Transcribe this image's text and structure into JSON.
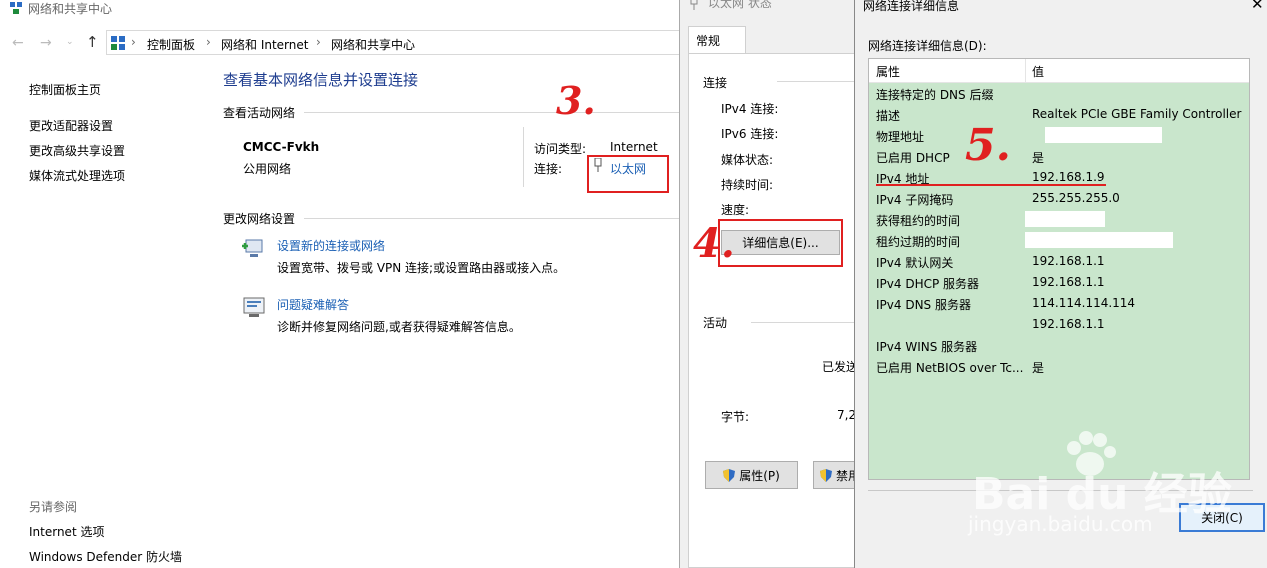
{
  "window": {
    "title": "网络和共享中心",
    "breadcrumb": [
      "控制面板",
      "网络和 Internet",
      "网络和共享中心"
    ]
  },
  "sidebar": {
    "home": "控制面板主页",
    "items": [
      "更改适配器设置",
      "更改高级共享设置",
      "媒体流式处理选项"
    ],
    "see_also_title": "另请参阅",
    "see_also": [
      "Internet 选项",
      "Windows Defender 防火墙"
    ]
  },
  "main": {
    "heading": "查看基本网络信息并设置连接",
    "active_networks_label": "查看活动网络",
    "network_name": "CMCC-Fvkh",
    "network_type": "公用网络",
    "access_type_label": "访问类型:",
    "access_type_value": "Internet",
    "connection_label": "连接:",
    "connection_value": "以太网",
    "change_settings_label": "更改网络设置",
    "actions": [
      {
        "title": "设置新的连接或网络",
        "desc": "设置宽带、拨号或 VPN 连接;或设置路由器或接入点。"
      },
      {
        "title": "问题疑难解答",
        "desc": "诊断并修复网络问题,或者获得疑难解答信息。"
      }
    ]
  },
  "status_dialog": {
    "title": "以太网 状态",
    "tab": "常规",
    "connection_group": "连接",
    "fields": [
      "IPv4 连接:",
      "IPv6 连接:",
      "媒体状态:",
      "持续时间:",
      "速度:"
    ],
    "details_button": "详细信息(E)...",
    "activity_group": "活动",
    "sent_label": "已发送",
    "bytes_label": "字节:",
    "bytes_sent": "7,2",
    "properties_button": "属性(P)",
    "disable_button": "禁用"
  },
  "details_dialog": {
    "title": "网络连接详细信息",
    "label": "网络连接详细信息(D):",
    "col_property": "属性",
    "col_value": "值",
    "rows": [
      {
        "k": "连接特定的 DNS 后缀",
        "v": ""
      },
      {
        "k": "描述",
        "v": "Realtek PCIe GBE Family Controller"
      },
      {
        "k": "物理地址",
        "v": ""
      },
      {
        "k": "已启用 DHCP",
        "v": "是"
      },
      {
        "k": "IPv4 地址",
        "v": "192.168.1.9"
      },
      {
        "k": "IPv4 子网掩码",
        "v": "255.255.255.0"
      },
      {
        "k": "获得租约的时间",
        "v": ""
      },
      {
        "k": "租约过期的时间",
        "v": ""
      },
      {
        "k": "IPv4 默认网关",
        "v": "192.168.1.1"
      },
      {
        "k": "IPv4 DHCP 服务器",
        "v": "192.168.1.1"
      },
      {
        "k": "IPv4 DNS 服务器",
        "v": "114.114.114.114"
      },
      {
        "k": "",
        "v": "192.168.1.1"
      },
      {
        "k": "IPv4 WINS 服务器",
        "v": ""
      },
      {
        "k": "已启用 NetBIOS over Tc...",
        "v": "是"
      }
    ],
    "close_button": "关闭(C)"
  },
  "annotations": [
    "3.",
    "4.",
    "5."
  ],
  "watermark": {
    "brand": "Bai du 经验",
    "url": "jingyan.baidu.com"
  },
  "colors": {
    "link": "#1a5fb4",
    "table_bg": "#c9e6cc",
    "annotation": "#e02020"
  }
}
